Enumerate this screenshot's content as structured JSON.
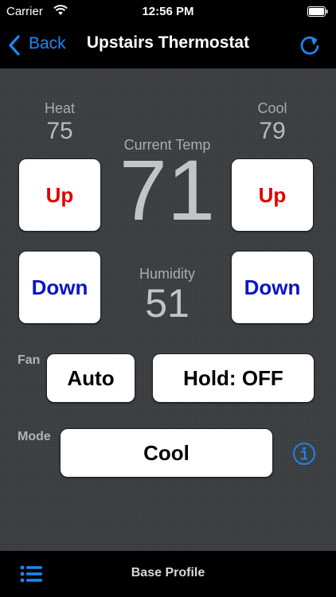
{
  "status_bar": {
    "carrier": "Carrier",
    "time": "12:56 PM"
  },
  "nav": {
    "back_label": "Back",
    "title": "Upstairs Thermostat"
  },
  "thermostat": {
    "heat_label": "Heat",
    "heat_value": "75",
    "cool_label": "Cool",
    "cool_value": "79",
    "current_temp_label": "Current Temp",
    "current_temp_value": "71",
    "humidity_label": "Humidity",
    "humidity_value": "51",
    "up_label": "Up",
    "down_label": "Down"
  },
  "fan": {
    "label": "Fan",
    "auto_label": "Auto",
    "hold_label": "Hold: OFF"
  },
  "mode": {
    "label": "Mode",
    "value": "Cool"
  },
  "tab_bar": {
    "profile_label": "Base Profile"
  },
  "colors": {
    "accent_blue": "#1e88f5",
    "up_red": "#e00000",
    "down_blue": "#0a14c8",
    "background": "#3a3d40"
  },
  "icons": {
    "status": [
      "wifi-icon",
      "battery-icon"
    ],
    "nav": [
      "chevron-left-icon",
      "refresh-icon"
    ],
    "main": [
      "info-icon"
    ],
    "tab": [
      "list-icon"
    ]
  }
}
